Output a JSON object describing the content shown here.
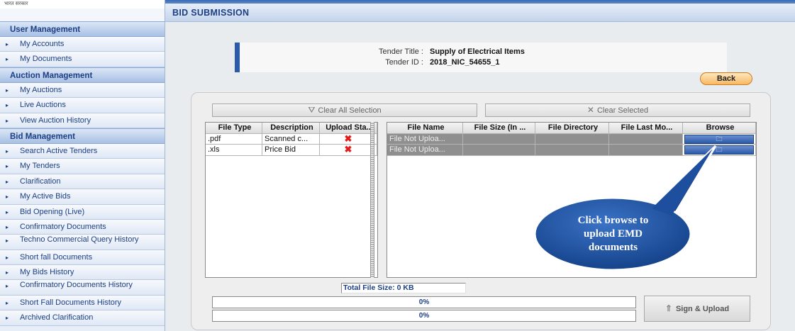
{
  "logo": {
    "text": "भारत सरकार"
  },
  "sidebar": {
    "sections": [
      {
        "title": "User Management",
        "items": [
          "My Accounts",
          "My Documents"
        ]
      },
      {
        "title": "Auction Management",
        "items": [
          "My Auctions",
          "Live Auctions",
          "View Auction History"
        ]
      },
      {
        "title": "Bid Management",
        "items": [
          "Search Active Tenders",
          "My Tenders",
          "Clarification",
          "My Active Bids",
          "Bid Opening (Live)",
          "Confirmatory Documents",
          "Techno Commercial Query History",
          "Short fall Documents",
          "My Bids History",
          "Confirmatory Documents History",
          "Short Fall Documents History",
          "Archived Clarification"
        ]
      }
    ]
  },
  "page": {
    "title": "BID SUBMISSION"
  },
  "tender": {
    "title_label": "Tender Title :",
    "title_value": "Supply of Electrical Items",
    "id_label": "Tender ID :",
    "id_value": "2018_NIC_54655_1"
  },
  "back_button": "Back",
  "toolbar": {
    "clear_all": "Clear All Selection",
    "clear_selected": "Clear Selected"
  },
  "left_table": {
    "headers": [
      "File Type",
      "Description",
      "Upload Sta..."
    ],
    "rows": [
      {
        "type": ".pdf",
        "description": "Scanned c...",
        "status": "✖"
      },
      {
        "type": ".xls",
        "description": "Price Bid",
        "status": "✖"
      }
    ]
  },
  "right_table": {
    "headers": [
      "File Name",
      "File Size (In ...",
      "File Directory",
      "File Last Mo...",
      "Browse"
    ],
    "rows": [
      {
        "file_name": "File Not Uploa...",
        "file_size": "",
        "directory": "",
        "last_modified": ""
      },
      {
        "file_name": "File Not Uploa...",
        "file_size": "",
        "directory": "",
        "last_modified": ""
      }
    ]
  },
  "total_file_size": "Total File Size: 0 KB",
  "progress": [
    {
      "label": "0%",
      "value": 0
    },
    {
      "label": "0%",
      "value": 0
    }
  ],
  "sign_upload_button": "Sign & Upload",
  "callout": {
    "text": "Click browse to upload EMD documents",
    "color": "#1d4f9e"
  },
  "colors": {
    "accent": "#1c3f84",
    "status_error": "#e21b1b",
    "back_button": "#f6b763"
  }
}
